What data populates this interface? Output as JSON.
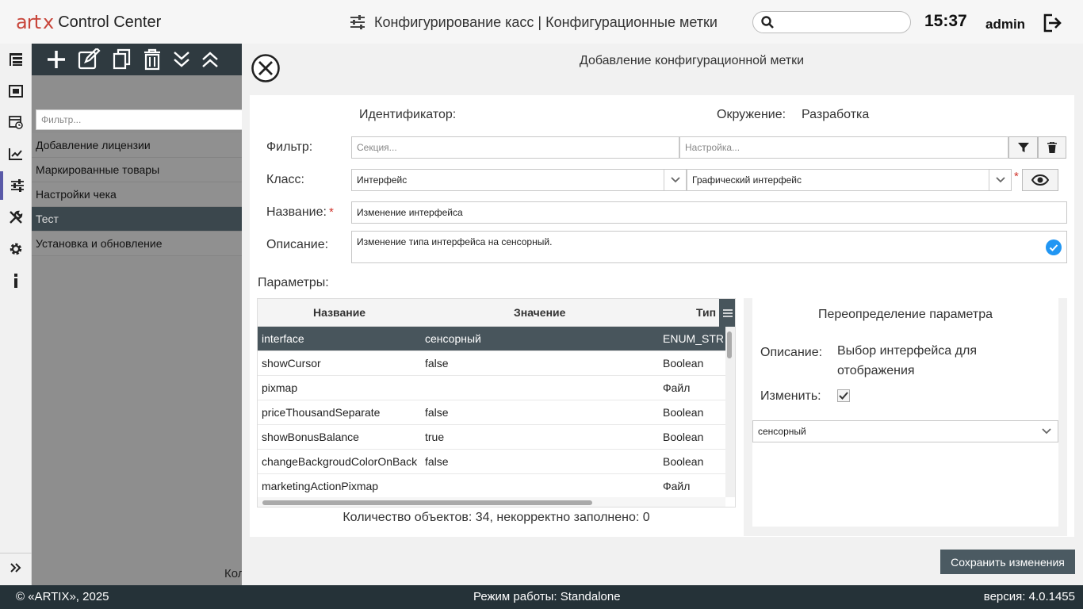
{
  "header": {
    "logo_art": "art",
    "logo_x": "x",
    "logo_text": "Control Center",
    "title": "Конфигурирование касс | Конфигурационные метки",
    "search_placeholder": "",
    "clock": "15:37",
    "user": "admin"
  },
  "nav": {
    "items": [
      "tree-icon",
      "monitor-icon",
      "calendar-clock-icon",
      "chart-line-icon",
      "sliders-icon",
      "tools-icon",
      "gear-icon",
      "info-icon"
    ],
    "active_index": 4
  },
  "underlying": {
    "filter_placeholder": "Фильтр...",
    "items": [
      "Добавление лицензии",
      "Маркированные товары",
      "Настройки чека",
      "Тест",
      "Установка и обновление"
    ],
    "selected_index": 3,
    "count_fragment": "Кол"
  },
  "modal": {
    "title": "Добавление конфигурационной метки",
    "identifier_label": "Идентификатор:",
    "identifier_value": "",
    "env_label": "Окружение:",
    "env_value": "Разработка",
    "filter_label": "Фильтр:",
    "filter_section_placeholder": "Секция...",
    "filter_setting_placeholder": "Настройка...",
    "class_label": "Класс:",
    "class_value": "Интерфейс",
    "subclass_value": "Графический интерфейс",
    "name_label": "Название:",
    "name_value": "Изменение интерфейса",
    "desc_label": "Описание:",
    "desc_value": "Изменение типа интерфейса на сенсорный.",
    "params_label": "Параметры:",
    "required_mark": "*"
  },
  "table": {
    "columns": [
      "Название",
      "Значение",
      "Тип"
    ],
    "rows": [
      {
        "name": "interface",
        "value": "сенсорный",
        "type": "ENUM_STRING"
      },
      {
        "name": "showCursor",
        "value": "false",
        "type": "Boolean"
      },
      {
        "name": "pixmap",
        "value": "",
        "type": "Файл"
      },
      {
        "name": "priceThousandSeparate",
        "value": "false",
        "type": "Boolean"
      },
      {
        "name": "showBonusBalance",
        "value": "true",
        "type": "Boolean"
      },
      {
        "name": "changeBackgroudColorOnBack",
        "value": "false",
        "type": "Boolean"
      },
      {
        "name": "marketingActionPixmap",
        "value": "",
        "type": "Файл"
      }
    ],
    "selected_index": 0,
    "count_text": "Количество объектов: 34, некорректно заполнено: 0"
  },
  "override": {
    "title": "Переопределение параметра",
    "desc_label": "Описание:",
    "desc_line1": "Выбор интерфейса для",
    "desc_line2": "отображения",
    "change_label": "Изменить:",
    "change_checked": true,
    "value": "сенсорный"
  },
  "save_label": "Сохранить изменения",
  "footer": {
    "copyright": "© «ARTIX», 2025",
    "mode": "Режим работы: Standalone",
    "version": "версия: 4.0.1455"
  },
  "colors": {
    "accent": "#c8453a",
    "dark": "#253238",
    "selected_row": "#48555c",
    "check_blue": "#2196f3"
  }
}
